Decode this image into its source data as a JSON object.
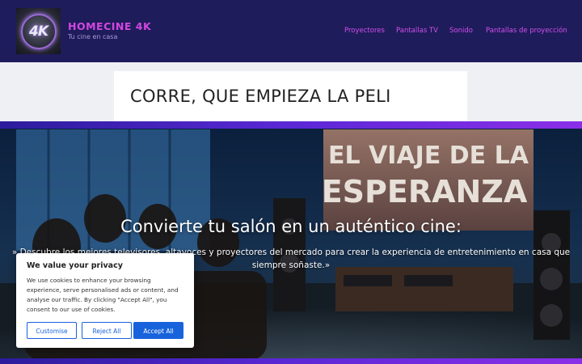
{
  "header": {
    "logo_text": "4K",
    "site_title": "HOMECINE 4K",
    "tagline": "Tu cine en casa",
    "nav": [
      {
        "label": "Proyectores"
      },
      {
        "label": "Pantallas TV"
      },
      {
        "label": "Sonido"
      },
      {
        "label": "Pantallas de proyección"
      }
    ]
  },
  "main": {
    "page_title": "CORRE, QUE EMPIEZA LA PELI"
  },
  "hero": {
    "screen_text_line1": "EL VIAJE DE LA",
    "screen_text_line2": "ESPERANZA",
    "headline": "Convierte tu salón en un auténtico cine:",
    "subtext": "» Descubre los mejores televisores, altavoces y proyectores del mercado para crear la experiencia de entretenimiento en casa que siempre soñaste.»"
  },
  "cookie_banner": {
    "title": "We value your privacy",
    "body": "We use cookies to enhance your browsing experience, serve personalised ads or content, and analyse our traffic. By clicking \"Accept All\", you consent to our use of cookies.",
    "customise_label": "Customise",
    "reject_label": "Reject All",
    "accept_label": "Accept All"
  },
  "colors": {
    "header_bg": "#1f1c5c",
    "brand_magenta": "#d347e0",
    "accent_purple": "#5b28d6",
    "cookie_button_blue": "#1863dc"
  }
}
